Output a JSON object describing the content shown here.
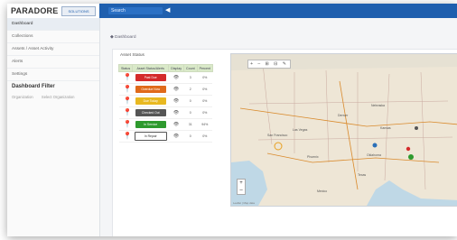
{
  "header": {
    "logo": "PARADORE",
    "logo_badge": "SOLUTIONS",
    "search_tab": "Search",
    "arrow": "◀"
  },
  "sidebar": {
    "items": [
      {
        "label": "Dashboard",
        "active": true
      },
      {
        "label": "Collections"
      },
      {
        "label": "Assets / Asset Activity"
      },
      {
        "label": "Alerts"
      },
      {
        "label": "Settings"
      }
    ],
    "filter_header": "Dashboard Filter",
    "filter_label": "Organization",
    "filter_value": "Select Organization"
  },
  "main": {
    "breadcrumb": "◆ Dashboard",
    "panel_title": "Asset Status",
    "table": {
      "headers": [
        "Status",
        "Asset Status/Alerts",
        "Display",
        "Count",
        "Percent"
      ],
      "rows": [
        {
          "pin_color": "#d42b2b",
          "label": "Past Due",
          "color": "#d42b2b",
          "outline": false,
          "count": "3",
          "percent": "0%"
        },
        {
          "pin_color": "#e06a1a",
          "label": "Overdue Now",
          "color": "#e06a1a",
          "outline": false,
          "count": "2",
          "percent": "0%"
        },
        {
          "pin_color": "#e8b820",
          "label": "Due Today",
          "color": "#e8b820",
          "outline": false,
          "count": "0",
          "percent": "0%"
        },
        {
          "pin_color": "#2a6fb8",
          "label": "Checked Out",
          "color": "#555555",
          "outline": false,
          "count": "0",
          "percent": "0%"
        },
        {
          "pin_color": "#2e9a2e",
          "label": "In Service",
          "color": "#2e9a2e",
          "outline": false,
          "count": "31",
          "percent": "94%"
        },
        {
          "pin_color": "#999999",
          "label": "In Repair",
          "color": "#ffffff",
          "outline": true,
          "count": "0",
          "percent": "0%"
        }
      ]
    },
    "map": {
      "controls": "+ – ⊞ ⊟ ✎",
      "zoom_in": "+",
      "zoom_out": "–",
      "labels": [
        "San Francisco",
        "Las Vegas",
        "Phoenix",
        "Denver",
        "Nebraska",
        "Kansas",
        "Oklahoma",
        "Texas",
        "Mexico"
      ],
      "footer": "Leaflet | Map data"
    }
  }
}
